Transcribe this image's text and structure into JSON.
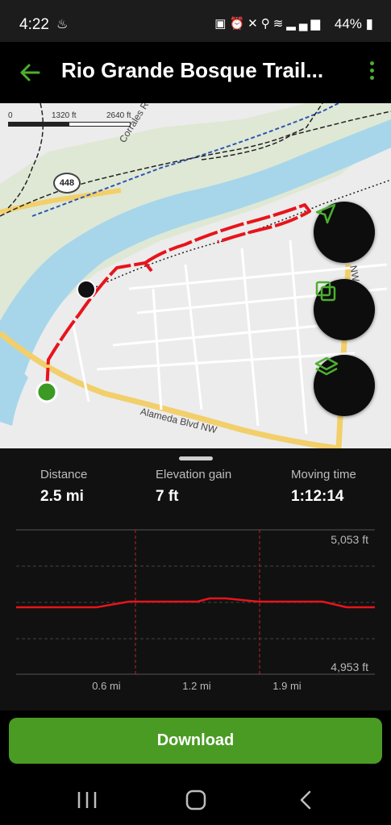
{
  "status_bar": {
    "time": "4:22",
    "battery": "44%",
    "icons": [
      "battery-saver-icon",
      "alarm-icon",
      "mute-icon",
      "location-icon",
      "wifi-icon",
      "signal-icon"
    ]
  },
  "app_bar": {
    "title": "Rio Grande Bosque Trail..."
  },
  "map": {
    "scale_labels": [
      "0",
      "1320 ft",
      "2640 ft"
    ],
    "highway_shield": "448",
    "road_labels": [
      "Corrales Rd",
      "Alameda Blvd NW",
      "NW"
    ],
    "route_color": "#e8141b",
    "start_marker_color": "#3a9a23",
    "end_marker_color": "#111111",
    "fab_icons": [
      "navigation-arrow-icon",
      "overlay-icon",
      "layers-icon"
    ]
  },
  "stats": {
    "distance": {
      "label": "Distance",
      "value": "2.5 mi"
    },
    "elevation_gain": {
      "label": "Elevation gain",
      "value": "7 ft"
    },
    "moving_time": {
      "label": "Moving time",
      "value": "1:12:14"
    }
  },
  "elevation_chart": {
    "y_max_label": "5,053 ft",
    "y_min_label": "4,953 ft",
    "x_labels": [
      "0.6 mi",
      "1.2 mi",
      "1.9 mi"
    ],
    "line_color": "#e8141b"
  },
  "download_button": {
    "label": "Download",
    "color": "#4a9b24"
  },
  "nav_bar": {
    "buttons": [
      "recent-apps-icon",
      "home-icon",
      "back-icon"
    ]
  }
}
